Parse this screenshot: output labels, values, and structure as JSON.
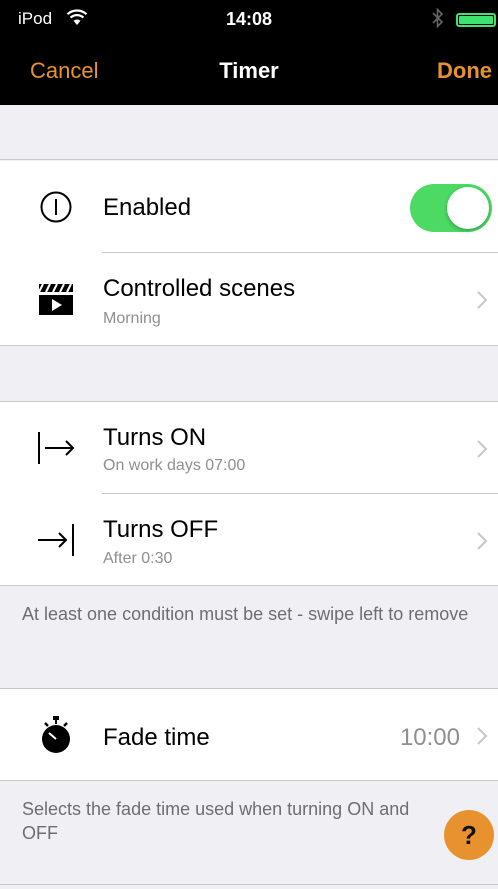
{
  "status_bar": {
    "carrier": "iPod",
    "wifi_icon": "wifi-icon",
    "time": "14:08",
    "bluetooth_icon": "bluetooth-icon",
    "battery_level": 1.0,
    "battery_color": "#3ee26e"
  },
  "nav": {
    "cancel_label": "Cancel",
    "title": "Timer",
    "done_label": "Done",
    "accent_color": "#e8922f"
  },
  "enabled": {
    "icon": "power-icon",
    "label": "Enabled",
    "toggle_on": true,
    "toggle_color": "#4cd964"
  },
  "scenes": {
    "icon": "clapperboard-icon",
    "label": "Controlled scenes",
    "value": "Morning"
  },
  "turns_on": {
    "icon": "turn-on-arrow-icon",
    "label": "Turns ON",
    "value": "On work days  07:00"
  },
  "turns_off": {
    "icon": "turn-off-arrow-icon",
    "label": "Turns OFF",
    "value": "After 0:30"
  },
  "conditions_note": "At least one condition must be set - swipe left to remove",
  "fade": {
    "icon": "stopwatch-icon",
    "label": "Fade time",
    "value": "10:00"
  },
  "fade_note": "Selects the fade time used when turning ON and OFF",
  "help": {
    "label": "?"
  }
}
